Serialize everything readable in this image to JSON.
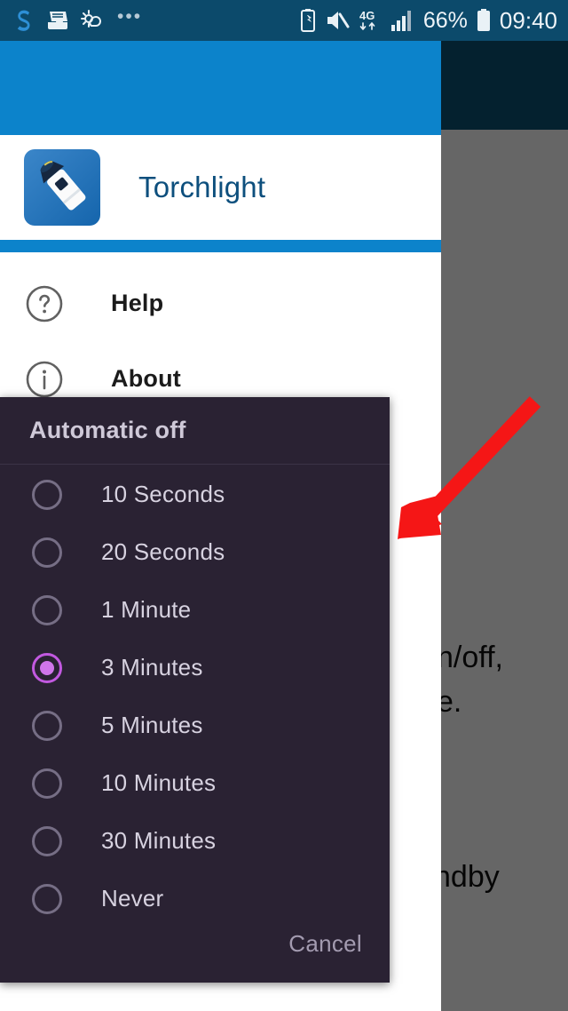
{
  "status_bar": {
    "left_icons": [
      "s-logo-icon",
      "inbox-tray-icon",
      "weather-sun-cloud-icon",
      "more-dots-icon"
    ],
    "right_icons": [
      "battery-saver-icon",
      "sound-muted-icon",
      "network-4g-icon",
      "signal-bars-icon",
      "battery-icon"
    ],
    "network_label": "4G",
    "battery_percent": "66%",
    "clock": "09:40"
  },
  "drawer": {
    "app_title": "Torchlight",
    "app_icon": "torch-flashlight-icon",
    "items": [
      {
        "label": "Help",
        "icon": "help-circle-icon"
      },
      {
        "label": "About",
        "icon": "info-circle-icon"
      }
    ]
  },
  "background_app": {
    "line1": "n/off,",
    "line2": "e.",
    "line3": "ndby"
  },
  "dialog": {
    "title": "Automatic off",
    "selected_value": "3 Minutes",
    "options": [
      {
        "label": "10 Seconds",
        "selected": false
      },
      {
        "label": "20 Seconds",
        "selected": false
      },
      {
        "label": "1 Minute",
        "selected": false
      },
      {
        "label": "3 Minutes",
        "selected": true
      },
      {
        "label": "5 Minutes",
        "selected": false
      },
      {
        "label": "10 Minutes",
        "selected": false
      },
      {
        "label": "30 Minutes",
        "selected": false
      },
      {
        "label": "Never",
        "selected": false
      }
    ],
    "cancel_label": "Cancel"
  },
  "annotation": {
    "type": "red-arrow",
    "color": "#f51616",
    "points_to": "dialog"
  },
  "colors": {
    "status_bar": "#0c4a6b",
    "drawer_accent": "#0c83cb",
    "app_title": "#0d4f7d",
    "dialog_background": "#2a2233",
    "radio_selected": "#c259e0",
    "annotation_red": "#f51616"
  }
}
